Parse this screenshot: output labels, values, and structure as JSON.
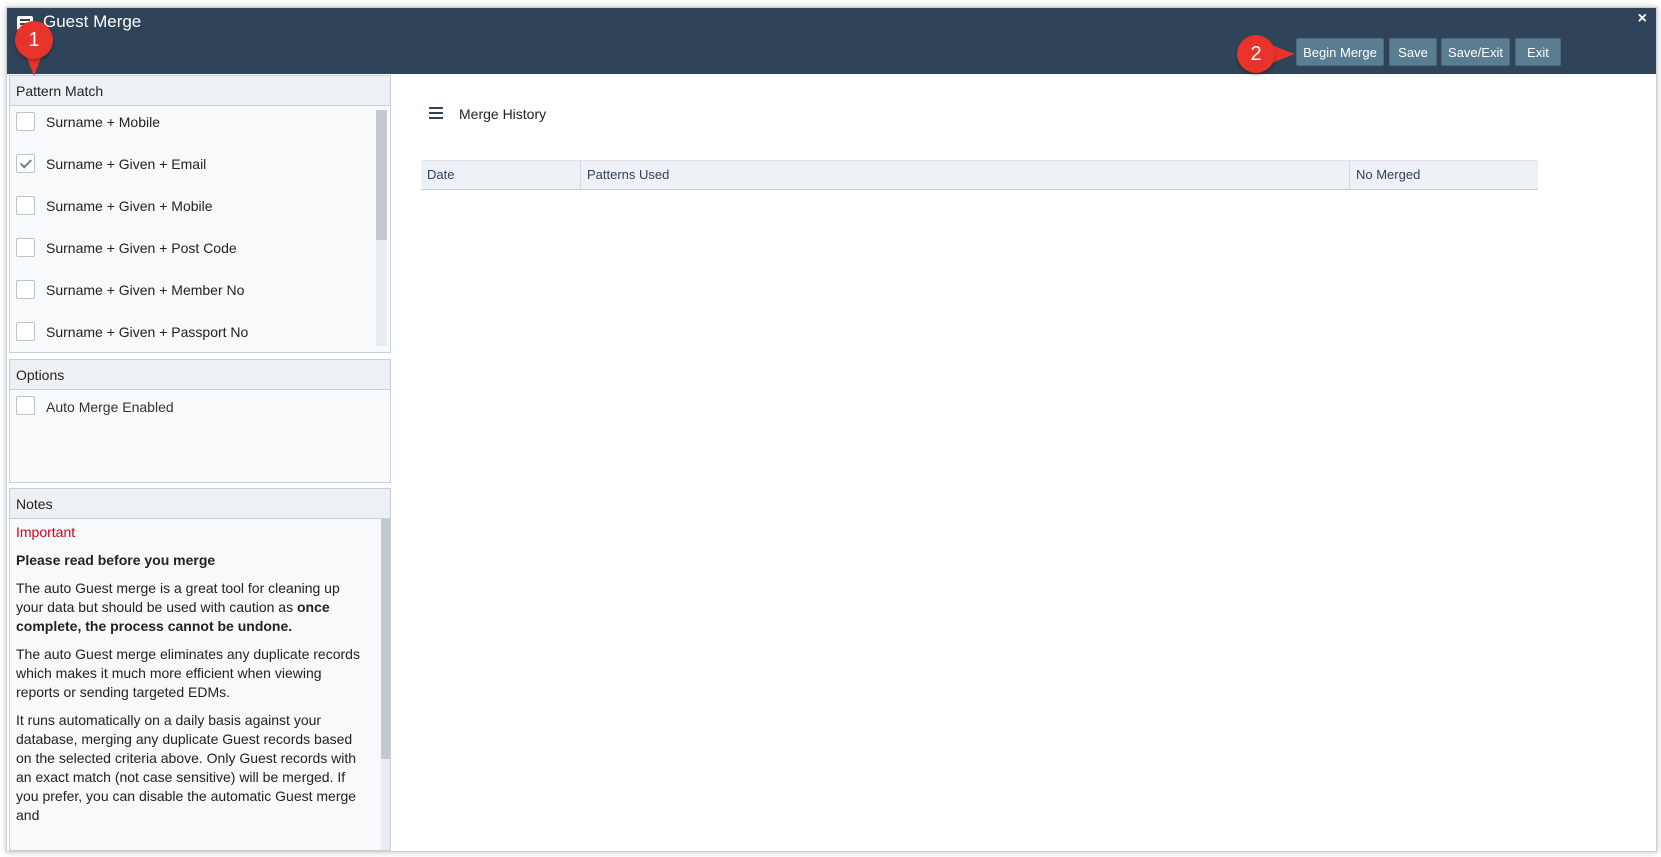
{
  "window": {
    "title": "Guest Merge",
    "close_icon": "×"
  },
  "toolbar": {
    "buttons": [
      {
        "label": "Begin Merge"
      },
      {
        "label": "Save"
      },
      {
        "label": "Save/Exit"
      },
      {
        "label": "Exit"
      }
    ]
  },
  "pattern_match": {
    "header": "Pattern Match",
    "items": [
      {
        "label": "Surname + Mobile",
        "checked": false
      },
      {
        "label": "Surname + Given + Email",
        "checked": true
      },
      {
        "label": "Surname + Given + Mobile",
        "checked": false
      },
      {
        "label": "Surname + Given + Post Code",
        "checked": false
      },
      {
        "label": "Surname + Given + Member No",
        "checked": false
      },
      {
        "label": "Surname + Given + Passport No",
        "checked": false
      }
    ]
  },
  "options": {
    "header": "Options",
    "items": [
      {
        "label": "Auto Merge Enabled",
        "checked": false
      }
    ]
  },
  "notes": {
    "header": "Notes",
    "important": "Important",
    "subheading": "Please read before you merge",
    "p1_start": "The auto Guest merge is a great tool for cleaning up your data but should be used with caution as ",
    "p1_bold": "once complete, the process cannot be undone.",
    "p2": "The auto Guest merge eliminates any duplicate records which makes it much more efficient when viewing reports or sending targeted EDMs.",
    "p3": "It runs automatically on a daily basis against your database, merging any duplicate Guest records based on the selected criteria above. Only Guest records with an exact match (not case sensitive) will be merged. If you prefer, you can disable the automatic Guest merge and"
  },
  "merge_history": {
    "title": "Merge History",
    "columns": [
      "Date",
      "Patterns Used",
      "No Merged"
    ]
  },
  "callouts": [
    "1",
    "2"
  ],
  "colors": {
    "titlebar": "#2f4359",
    "button": "#5b7d92",
    "important": "#d0021b",
    "callout": "#e8332a"
  }
}
